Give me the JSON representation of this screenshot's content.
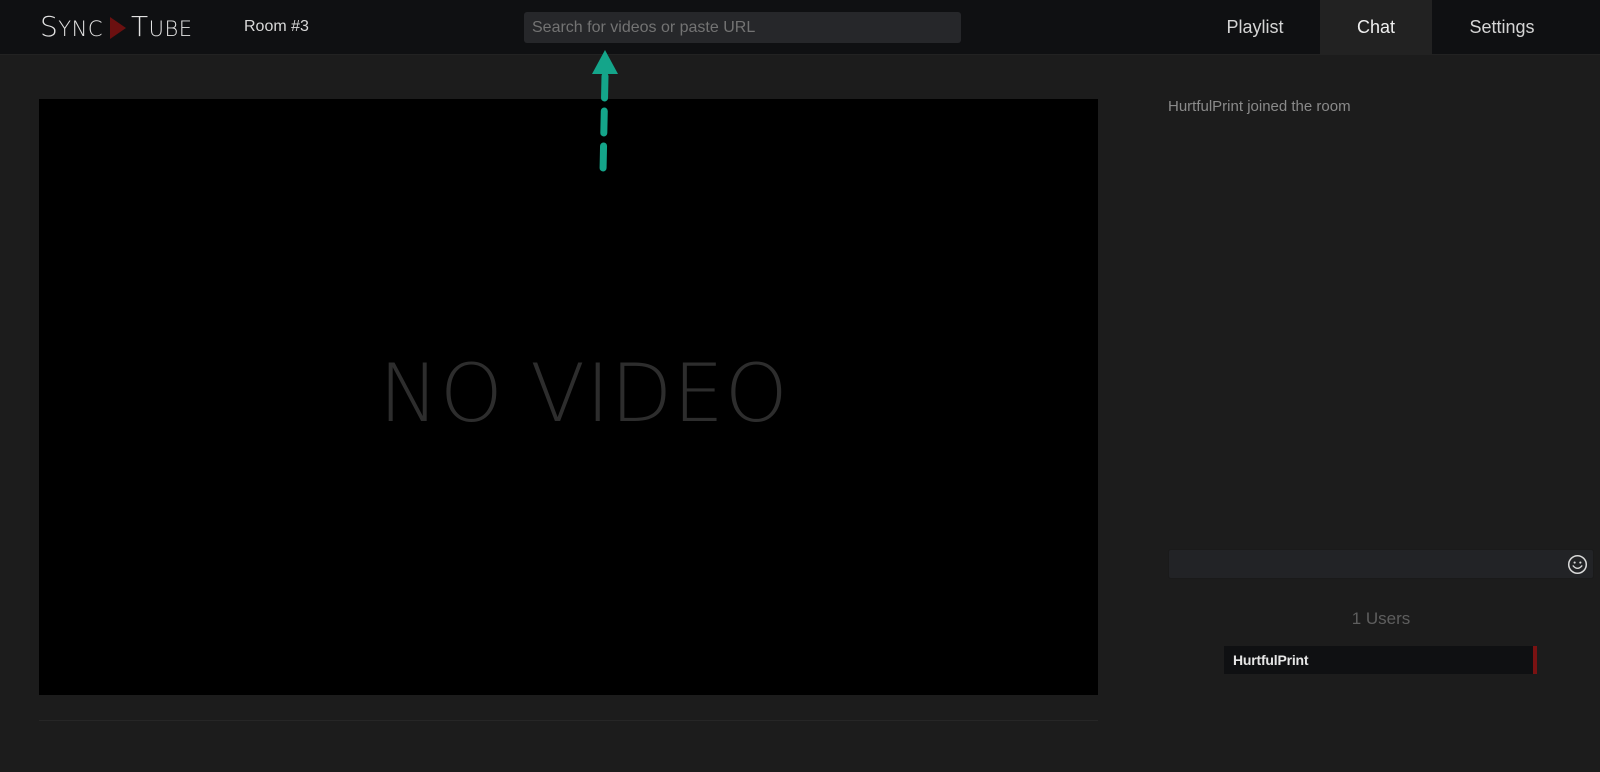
{
  "header": {
    "logo_part1_big": "S",
    "logo_part1_small": "YNC",
    "logo_part2_big": "T",
    "logo_part2_small": "UBE",
    "room": "Room #3",
    "search_placeholder": "Search for videos or paste URL",
    "search_value": ""
  },
  "nav": {
    "playlist": "Playlist",
    "chat": "Chat",
    "settings": "Settings",
    "active": "chat"
  },
  "player": {
    "placeholder_text": "NO VIDEO"
  },
  "chat": {
    "messages": [
      {
        "text": "HurtfulPrint joined the room"
      }
    ],
    "input_value": "",
    "users_count_label": "1 Users",
    "users": [
      {
        "name": "HurtfulPrint"
      }
    ]
  },
  "colors": {
    "background": "#1c1c1c",
    "topbar": "#0f1012",
    "accent_red": "#7a1212",
    "arrow": "#14a58a"
  },
  "icons": {
    "logo_separator": "play-triangle-icon",
    "emoji": "smiley-icon",
    "annotation": "dashed-up-arrow-icon"
  }
}
